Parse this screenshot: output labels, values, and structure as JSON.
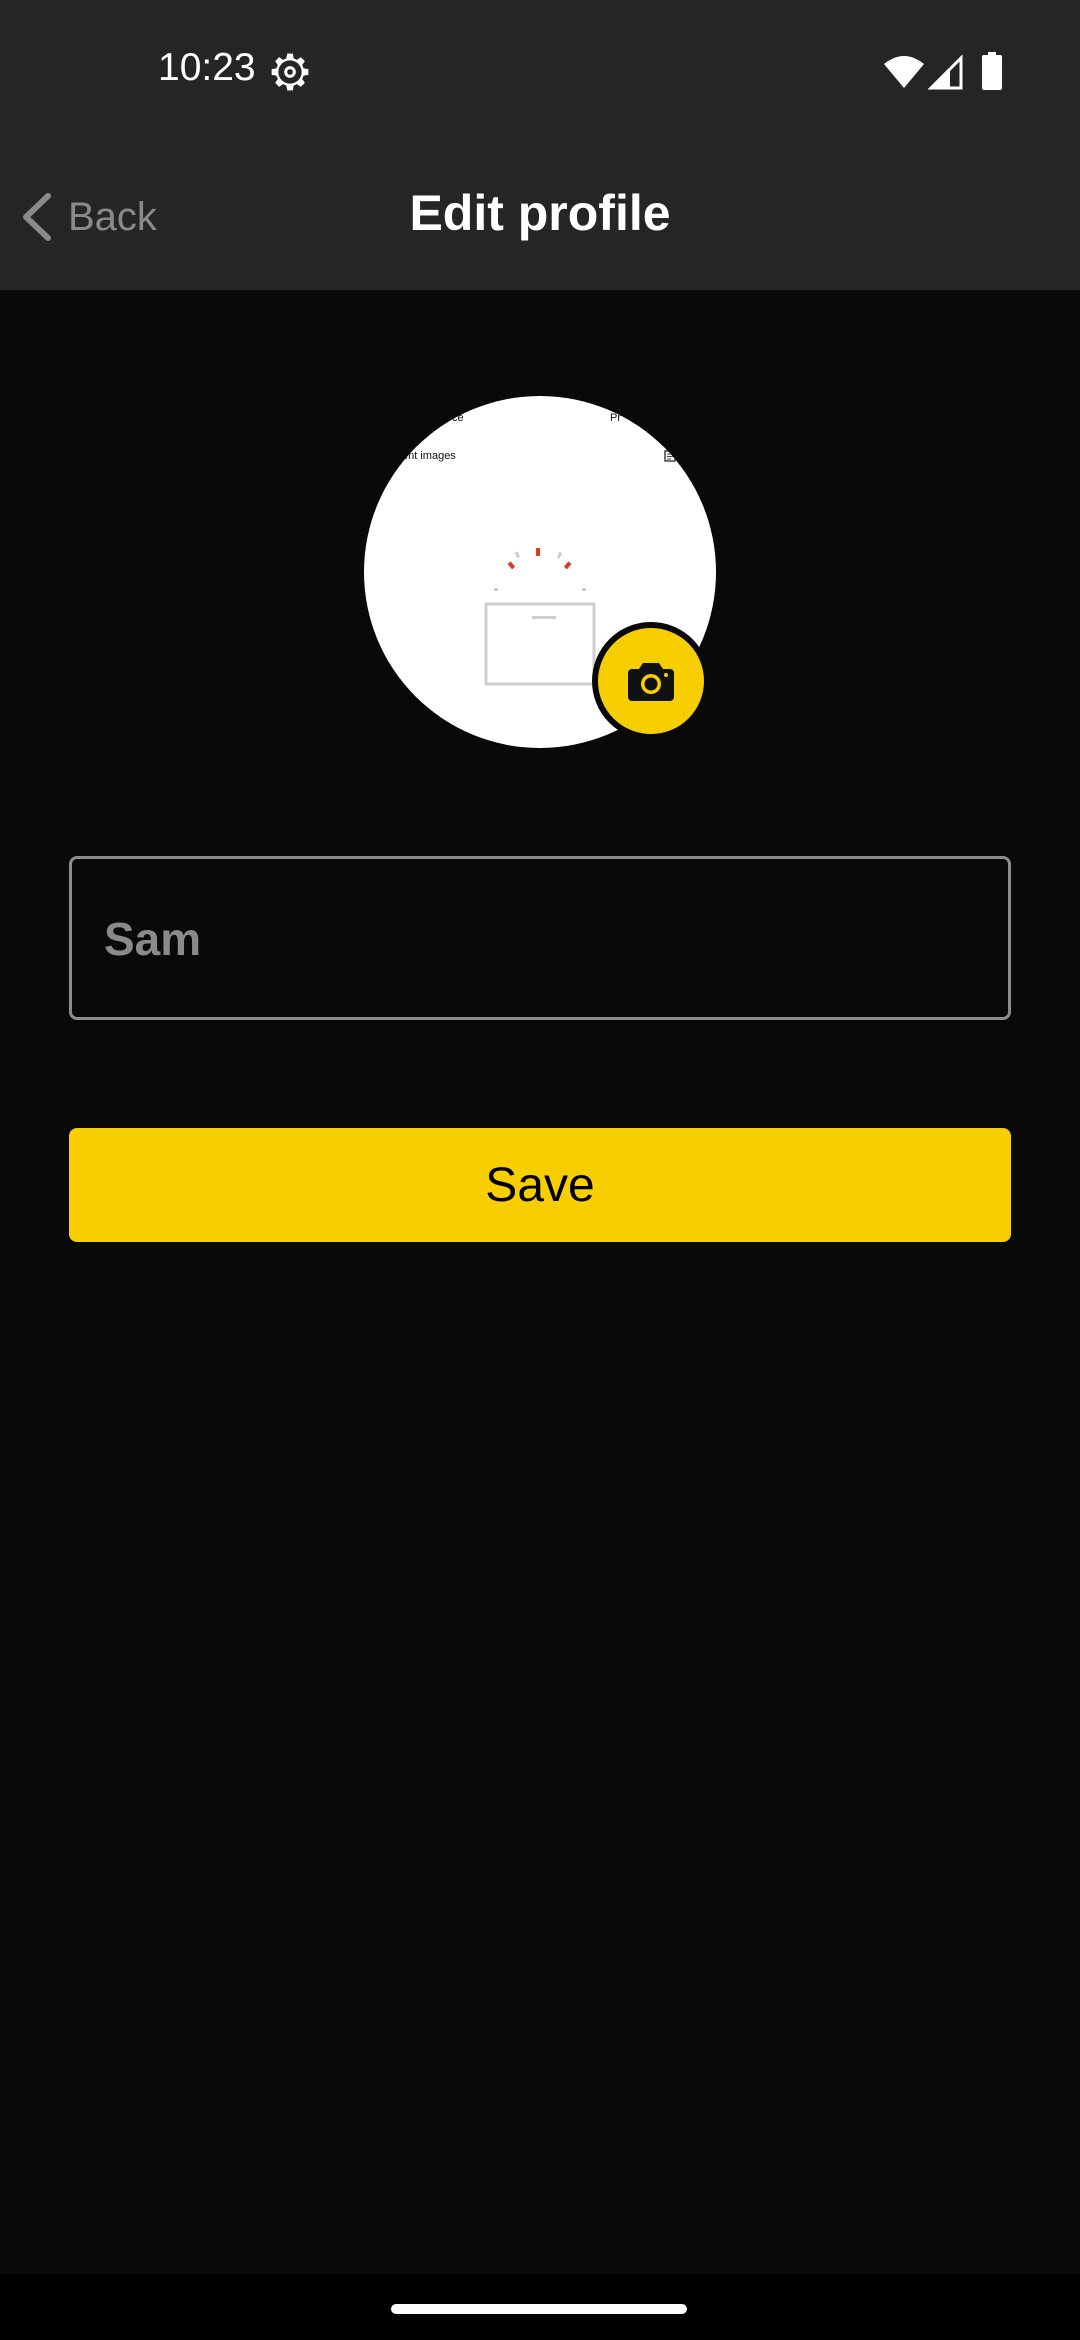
{
  "status_bar": {
    "time": "10:23",
    "icons": [
      "gear-icon",
      "wifi-icon",
      "signal-icon",
      "battery-icon"
    ]
  },
  "app_bar": {
    "back_label": "Back",
    "title": "Edit profile"
  },
  "avatar": {
    "visible_text": [
      "ce",
      "Pr",
      "ent images"
    ],
    "camera_button_icon": "camera-icon"
  },
  "name_field": {
    "value": "Sam"
  },
  "save_button": {
    "label": "Save"
  },
  "colors": {
    "accent": "#f7cf00",
    "background": "#090909",
    "bar": "#252525"
  }
}
